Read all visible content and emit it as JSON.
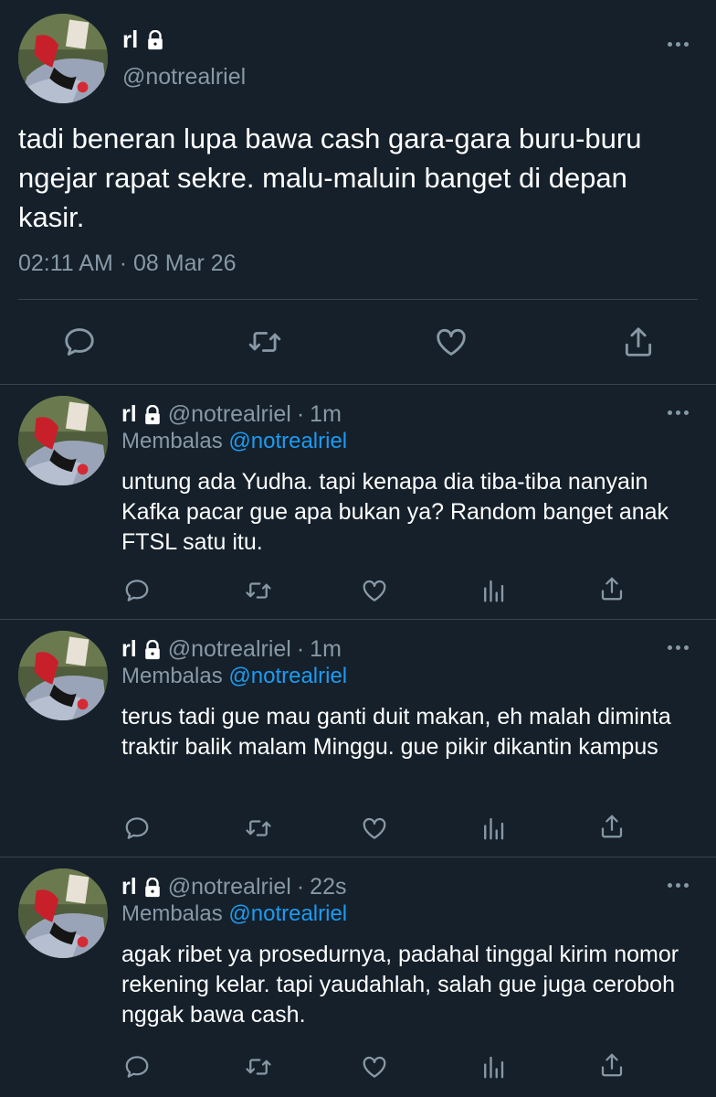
{
  "main_tweet": {
    "name": "rl",
    "handle": "@notrealriel",
    "text": "tadi beneran lupa bawa cash gara-gara buru-buru ngejar rapat sekre. malu-maluin banget di depan kasir.",
    "timestamp": "02:11 AM · 08 Mar 26",
    "actions": [
      "reply-icon",
      "retweet-icon",
      "like-icon",
      "share-icon"
    ]
  },
  "replies": [
    {
      "name": "rl",
      "handle": "@notrealriel",
      "dot": "·",
      "time": "1m",
      "replying_label": "Membalas",
      "replying_to": "@notrealriel",
      "text": "untung ada Yudha. tapi kenapa dia tiba-tiba nanyain Kafka pacar gue apa bukan ya? Random banget anak FTSL satu itu."
    },
    {
      "name": "rl",
      "handle": "@notrealriel",
      "dot": "·",
      "time": "1m",
      "replying_label": "Membalas",
      "replying_to": "@notrealriel",
      "text": "terus tadi gue mau ganti duit makan, eh malah diminta traktir balik malam Minggu. gue pikir dikantin kampus"
    },
    {
      "name": "rl",
      "handle": "@notrealriel",
      "dot": "·",
      "time": "22s",
      "replying_label": "Membalas",
      "replying_to": "@notrealriel",
      "text": "agak ribet ya prosedurnya, padahal tinggal kirim nomor rekening kelar. tapi yaudahlah, salah gue juga ceroboh nggak bawa cash."
    }
  ],
  "colors": {
    "background": "#15202b",
    "text_primary": "#ffffff",
    "text_secondary": "#8899a6",
    "accent": "#1d9bf0",
    "divider": "#38444d"
  }
}
